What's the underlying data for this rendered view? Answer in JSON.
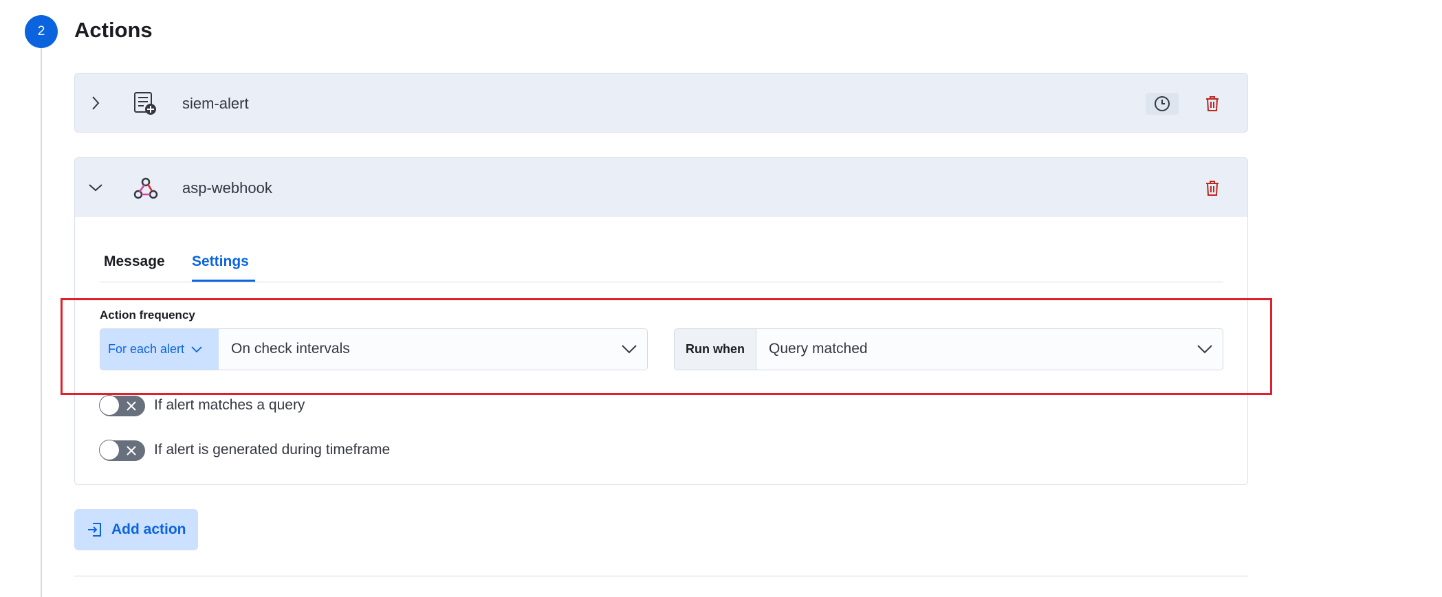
{
  "step": {
    "number": "2",
    "title": "Actions"
  },
  "actions": [
    {
      "name": "siem-alert",
      "icon": "index-connector-icon",
      "has_snooze": true
    },
    {
      "name": "asp-webhook",
      "icon": "webhook-icon",
      "has_snooze": false
    }
  ],
  "tabs": [
    {
      "label": "Message",
      "active": false
    },
    {
      "label": "Settings",
      "active": true
    }
  ],
  "frequency": {
    "label": "Action frequency",
    "summary_mode": "For each alert",
    "interval": "On check intervals",
    "run_when_label": "Run when",
    "run_when_value": "Query matched"
  },
  "toggles": [
    {
      "label": "If alert matches a query",
      "checked": false
    },
    {
      "label": "If alert is generated during timeframe",
      "checked": false
    }
  ],
  "add_action_label": "Add action",
  "colors": {
    "accent": "#0b64dd",
    "danger": "#bd271e",
    "highlight": "#e0202c"
  }
}
